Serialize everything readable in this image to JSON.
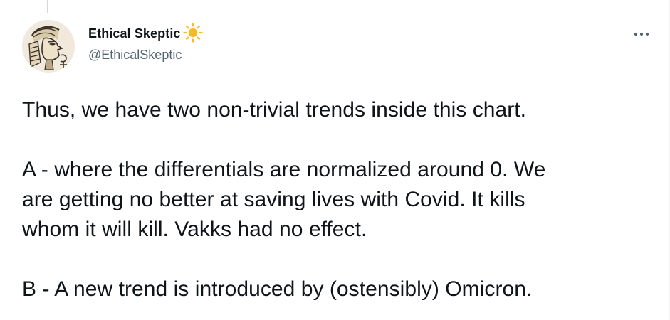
{
  "author": {
    "display_name": "Ethical Skeptic",
    "handle": "@EthicalSkeptic",
    "badge_icon": "sun-icon",
    "badge_color": "#f9b922"
  },
  "menu": {
    "icon": "more-horizontal-icon"
  },
  "tweet": {
    "paragraphs": [
      "Thus, we have two non-trivial trends inside this chart.",
      "A - where the differentials are normalized around 0. We\nare getting no better at saving lives with Covid. It kills\nwhom it will kill. Vakks had no effect.",
      "B - A new trend is introduced by (ostensibly) Omicron."
    ]
  },
  "colors": {
    "text_primary": "#0f1419",
    "text_secondary": "#536471",
    "thread_line": "#cfd9de"
  }
}
